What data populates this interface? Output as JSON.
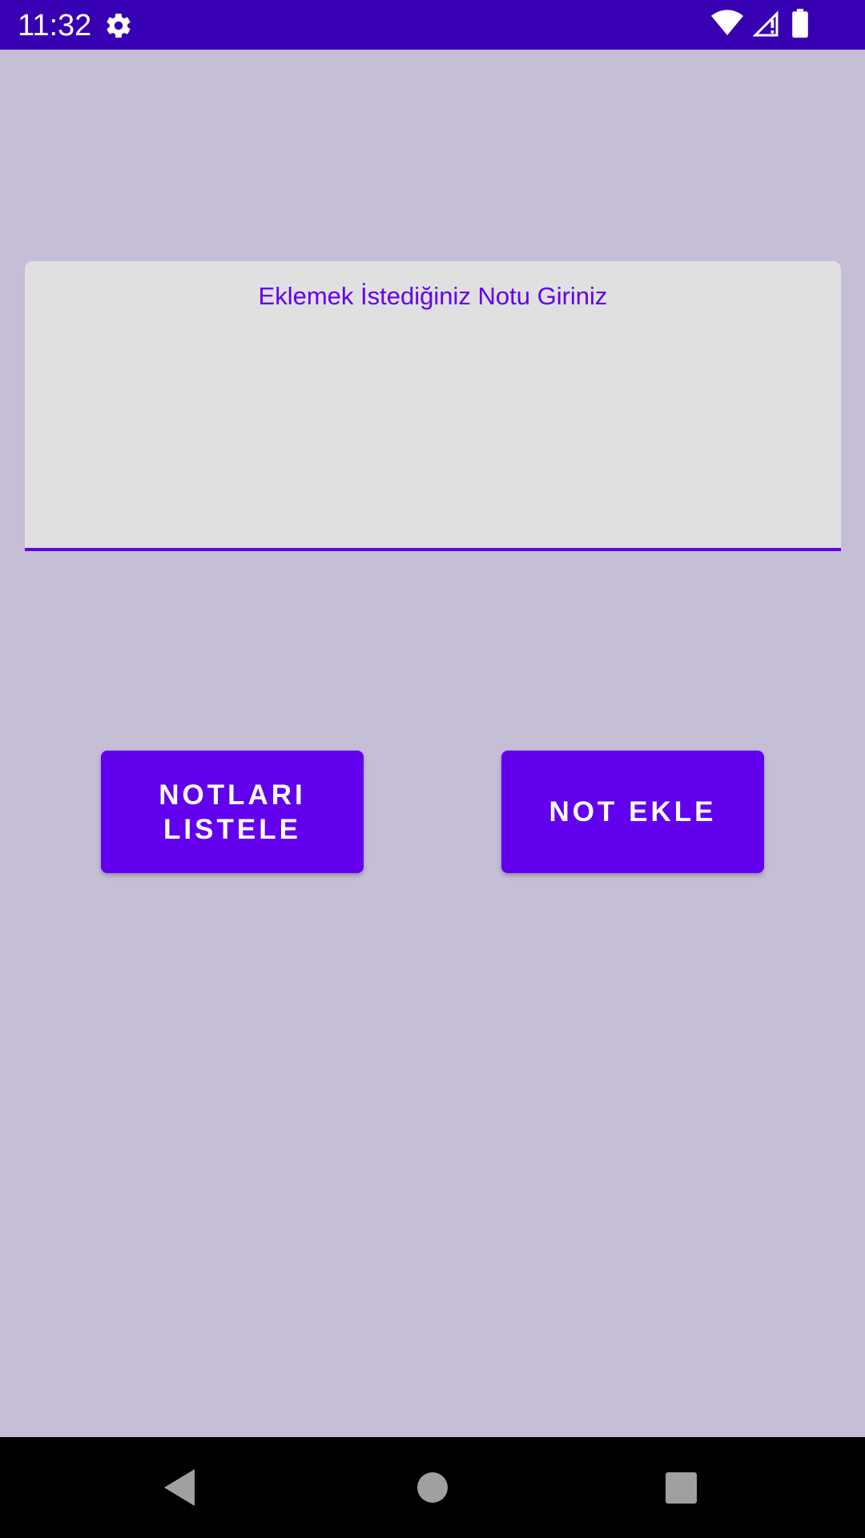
{
  "status_bar": {
    "time": "11:32",
    "background_color": "#3700b3",
    "icons": [
      "gear-icon",
      "wifi-icon",
      "signal-icon",
      "battery-icon"
    ]
  },
  "main": {
    "background_color": "#c6bed6",
    "note_input": {
      "placeholder": "Eklemek İstediğiniz Notu Giriniz",
      "value": "",
      "accent_color": "#6200ee"
    },
    "buttons": {
      "list_notes_label": "NOTLARI\nLISTELE",
      "list_notes_line1": "NOTLARI",
      "list_notes_line2": "LISTELE",
      "add_note_label": "NOT EKLE",
      "color": "#6200ee"
    }
  },
  "nav_bar": {
    "icons": [
      "back-icon",
      "home-icon",
      "recents-icon"
    ]
  }
}
